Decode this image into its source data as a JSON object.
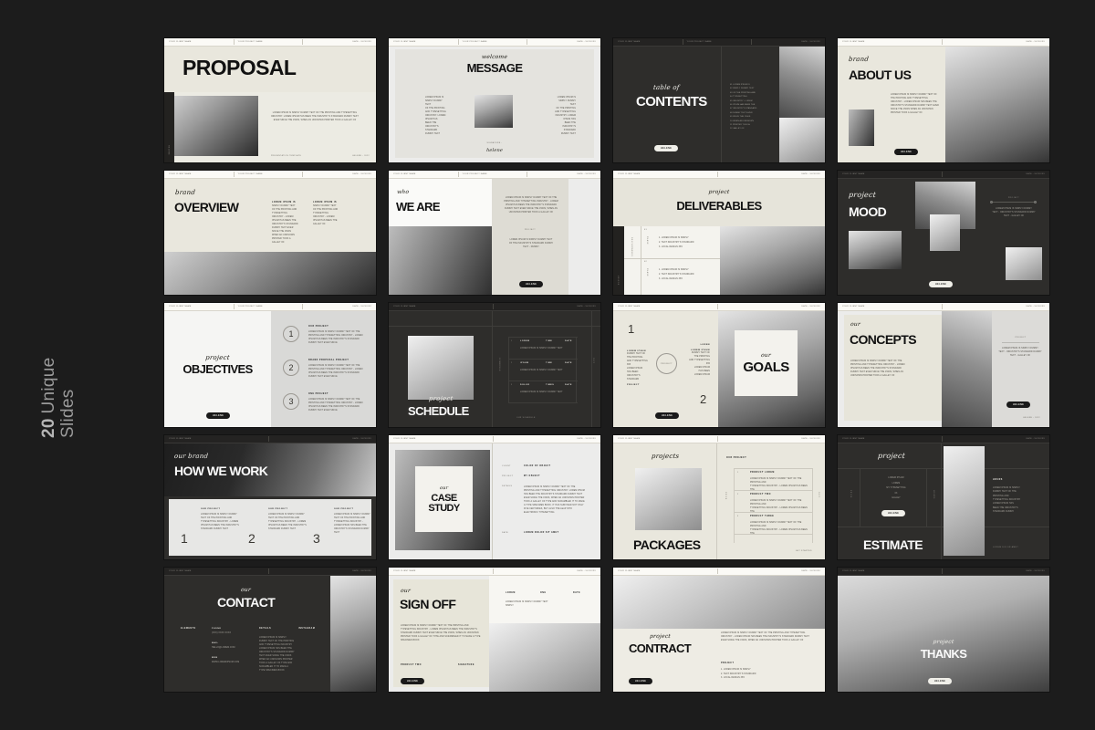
{
  "side_label": {
    "number": "20",
    "text": "Unique",
    "text2": "Slides"
  },
  "background_color": "#1c1c1c",
  "header": {
    "client": "YOUR CLIENT NAME",
    "project": "YOUR PROJECT NAME",
    "date": "DATE - XX/XX/XX"
  },
  "common": {
    "brand_pill": "HELENE",
    "lorem_short": "LOREM IPSUM IS SIMPLY DUMMY TEXT OF THE PRINTING AND TYPESETTING INDUSTRY. LOREM IPSUM HAS BEEN THE INDUSTRY'S STANDARD DUMMY TEXT EVER SINCE THE 1500S, WHEN AN UNKNOWN PRINTER TOOK A GALLEY OF",
    "lorem_tiny": "LOREM IPSUM IS SIMPLY DUMMY TEXT OF THE PRINTING AND TYPESETTING INDUSTRY. LOREM IPSUM HAS BEEN THE",
    "project_label": "PROJECT",
    "our_project": "OUR PROJECT"
  },
  "slides": [
    {
      "n": 1,
      "id": "proposal",
      "title": "PROPOSAL",
      "script": "",
      "footer_left": "PRESENTATION TEMPLATE",
      "footer_right": "HELENE  -  2022",
      "body": "LOREM IPSUM IS SIMPLY DUMMY TEXT OF THE PRINTING AND TYPESETTING INDUSTRY. LOREM IPSUM HAS BEEN THE INDUSTRY'S STANDARD DUMMY TEXT EVER SINCE THE 1500S, WHEN AN UNKNOWN PRINTER TOOK A GALLEY OF",
      "side_tag": "HELENE"
    },
    {
      "n": 2,
      "id": "message",
      "title": "MESSAGE",
      "script": "welcome",
      "signature_label": "SIGNATURE :",
      "signature": "helene",
      "col_left": "LOREM IPSUM IS\nSIMPLY DUMMY\nTEXT\nOF THE PRINTING\nAND TYPESETTING\nINDUSTRY. LOREM\nIPSUM HAS\nBEEN THE\nINDUSTRY'S\nSTANDARD\nDUMMY TEXT",
      "col_right": "LOREM IPSUM IS\nSIMPLY DUMMY\nTEXT\nOF THE PRINTING\nAND TYPESETTING\nINDUSTRY. LOREM\nIPSUM HAS\nBEEN THE\nINDUSTRY'S\nSTANDARD\nDUMMY TEXT"
    },
    {
      "n": 3,
      "id": "contents",
      "title": "CONTENTS",
      "script": "table of",
      "pill": "HELENE",
      "items": [
        "01  LOREM IPSUM IS",
        "02  SIMPLY DUMMY TEXT",
        "03  OF THE PRINTING AND",
        "04  TYPESETTING",
        "05  INDUSTRY - LOREM",
        "06  IPSUM HAS BEEN THE",
        "07  INDUSTRY'S STANDARD",
        "08  DUMMY TEXT EVER",
        "09  SINCE THE 1500S",
        "10  WHEN AN UNKNOWN",
        "11  PRINTER TOOK A",
        "12  GALLEY OF"
      ]
    },
    {
      "n": 4,
      "id": "about-us",
      "title": "ABOUT US",
      "script": "brand",
      "pill": "HELENE",
      "body": "LOREM IPSUM IS SIMPLY DUMMY TEXT OF THE PRINTING AND TYPESETTING INDUSTRY - LOREM IPSUM HAS BEEN THE INDUSTRY'S STANDARD DUMMY TEXT EVER SINCE THE 1500S WHEN AN UNKNOWN PRINTER TOOK A GALLEY OF"
    },
    {
      "n": 5,
      "id": "overview",
      "title": "OVERVIEW",
      "script": "brand",
      "col1_head": "LOREM IPSUM IS",
      "col1": "SIMPLY DUMMY TEXT\nOF THE PRINTING AND\nTYPESETTING\nINDUSTRY - LOREM\nIPSUM HAS BEEN THE\nINDUSTRY'S STANDARD\nDUMMY TEXT EVER\nSINCE THE 1500S\nWHEN AN UNKNOWN\nPRINTER TOOK A\nGALLEY OF",
      "col2_head": "LOREM IPSUM IS",
      "col2": "SIMPLY DUMMY TEXT\nOF THE PRINTING AND\nTYPESETTING\nINDUSTRY - LOREM\nIPSUM HAS BEEN THE\nGALLEY OF"
    },
    {
      "n": 6,
      "id": "we-are",
      "title": "WE ARE",
      "script": "who",
      "pill": "HELENE",
      "mid_label": "PROJECT",
      "body": "LOREM IPSUM IS SIMPLY DUMMY TEXT OF THE PRINTING AND TYPESETTING INDUSTRY - LOREM IPSUM HAS BEEN THE INDUSTRY'S STANDARD DUMMY TEXT EVER SINCE THE 1500S, WHEN AN UNKNOWN PRINTER TOOK A GALLEY OF",
      "body2": "LOREM IPSUM IS SIMPLY DUMMY TEXT\nOF THE INDUSTRY'S STANDARD DUMMY\nTEXT - DUMMY"
    },
    {
      "n": 7,
      "id": "deliverables",
      "title": "DELIVERABLES",
      "script": "project",
      "side_tag": "HELENE",
      "vtext": "DELIVERABLES",
      "groups": [
        {
          "label": "01",
          "vlabel": "PHASE",
          "items": [
            "1.  LOREM IPSUM IS SIMPLY",
            "2.  TEXT INDUSTRY'S STANDARD",
            "3.  LOCAL DESIGN 365"
          ]
        },
        {
          "label": "02",
          "vlabel": "PHASE",
          "items": [
            "1.  LOREM IPSUM IS SIMPLY",
            "2.  TEXT INDUSTRY'S STANDARD",
            "3.  LOCAL DESIGN 365"
          ]
        }
      ]
    },
    {
      "n": 8,
      "id": "mood",
      "title": "MOOD",
      "script": "project",
      "pill": "HELENE",
      "right_label": "PROJECT",
      "right_body": "LOREM IPSUM IS SIMPLY DUMMY\nTEXT - INDUSTRY'S STANDARD DUMMY\nTEXT - GALLEY OF"
    },
    {
      "n": 9,
      "id": "objectives",
      "title": "OBJECTIVES",
      "script": "project",
      "pill": "HELENE",
      "rows": [
        {
          "num": "1",
          "head": "OUR PROJECT",
          "body": "LOREM IPSUM IS SIMPLY DUMMY TEXT OF THE PRINTING AND TYPESETTING INDUSTRY - LOREM IPSUM HAS BEEN THE INDUSTRY'S STANDARD DUMMY TEXT EVER SINCE"
        },
        {
          "num": "2",
          "head": "BRAND PROPOSAL PROJECT",
          "body": "LOREM IPSUM IS SIMPLY DUMMY TEXT OF THE PRINTING AND TYPESETTING INDUSTRY - LOREM IPSUM HAS BEEN THE INDUSTRY'S STANDARD DUMMY TEXT EVER SINCE"
        },
        {
          "num": "3",
          "head": "ONE PROJECT",
          "body": "LOREM IPSUM IS SIMPLY DUMMY TEXT OF THE PRINTING AND TYPESETTING INDUSTRY - LOREM IPSUM HAS BEEN THE INDUSTRY'S STANDARD DUMMY TEXT EVER SINCE"
        }
      ]
    },
    {
      "n": 10,
      "id": "schedule",
      "title": "SCHEDULE",
      "script": "project",
      "vtext_left": "SCHEDULE",
      "vtext_right": "2022",
      "footer": "OUR  SCHEDULE",
      "rows": [
        {
          "num": "1",
          "c1": "LOREM",
          "c2": "TIME",
          "c3": "DATE",
          "sub": "LOREM IPSUM IS SIMPLY DUMMY TEXT"
        },
        {
          "num": "2",
          "c1": "IPSUM",
          "c2": "TIME",
          "c3": "DATE",
          "sub": "LOREM IPSUM IS SIMPLY DUMMY TEXT"
        },
        {
          "num": "3",
          "c1": "DOLOR",
          "c2": "TIMES",
          "c3": "DATE",
          "sub": "LOREM IPSUM IS SIMPLY DUMMY TEXT"
        }
      ]
    },
    {
      "n": 11,
      "id": "goals",
      "title": "GOALS",
      "script": "our",
      "pill": "HELENE",
      "circle_label": "PROJECT",
      "num1": "1",
      "num2": "2",
      "col1_head": "LOREM IPSUM",
      "col1": "DUMMY TEXT OF\nTHE PRINTING\nAND TYPESETTING\n365\nLOREM IPSUM\nHAS BEEN\nINDUSTRY'S\nSTANDARD",
      "col1_foot": "PROJECT",
      "col2_head": "LOREM IPSUM",
      "col2": "DUMMY TEXT OF\nTHE PRINTING\nAND TYPESETTING\n365\nLOREM IPSUM\nHAS BEEN\nLOREM IPSUM",
      "col2_top": "LOREM"
    },
    {
      "n": 12,
      "id": "concepts",
      "title": "CONCEPTS",
      "script": "our",
      "pill": "HELENE",
      "right_label": "PROJECT",
      "footer": "HELENE  -  2022",
      "body": "LOREM IPSUM IS SIMPLY DUMMY TEXT OF THE PRINTING AND TYPESETTING INDUSTRY - LOREM IPSUM HAS BEEN THE INDUSTRY'S STANDARD DUMMY TEXT EVER SINCE THE 1500S, WHEN AN UNKNOWN PRINTER TOOK A GALLEY OF",
      "right_body": "LOREM IPSUM IS SIMPLY DUMMY\nTEXT - INDUSTRY'S STANDARD DUMMY\nTEXT - GALLEY OF"
    },
    {
      "n": 13,
      "id": "how-we-work",
      "title": "HOW WE WORK",
      "script": "our brand",
      "cols": [
        {
          "num": "1",
          "head": "OUR PROJECT",
          "body": "LOREM IPSUM IS SIMPLY DUMMY TEXT OF THE PRINTING AND TYPESETTING INDUSTRY - LOREM IPSUM HAS BEEN THE INDUSTRY'S STANDARD DUMMY TEXT"
        },
        {
          "num": "2",
          "head": "OUR PROJECT",
          "body": "LOREM IPSUM IS SIMPLY DUMMY TEXT OF THE PRINTING AND TYPESETTING INDUSTRY - LOREM IPSUM HAS BEEN THE INDUSTRY'S STANDARD DUMMY TEXT"
        },
        {
          "num": "3",
          "head": "OUR PROJECT",
          "body": "LOREM IPSUM IS SIMPLY DUMMY TEXT OF THE PRINTING AND TYPESETTING INDUSTRY - LOREM IPSUM HAS BEEN THE INDUSTRY'S STANDARD DUMMY TEXT"
        }
      ]
    },
    {
      "n": 14,
      "id": "case-study",
      "title_1": "CASE",
      "title_2": "STUDY",
      "script": "our",
      "rows": [
        {
          "label": "CLIENT",
          "value": "COLOR OF OBJECT"
        },
        {
          "label": "PROJECT",
          "value": "MY OBJECT"
        },
        {
          "label": "DETAILS",
          "value": "LOREM IPSUM IS SIMPLY DUMMY TEXT OF THE PRINTING AND TYPESETTING INDUSTRY. LOREM IPSUM HAS BEEN THE INDUSTRY'S STANDARD DUMMY TEXT EVER SINCE THE 1500S, WHEN AN UNKNOWN PRINTER TOOK A GALLEY OF TYPE AND SCRAMBLED IT TO MAKE A TYPE SPECIMEN BOOK. IT HAS SURVIVED NOT ONLY FIVE CENTURIES, BUT ALSO THE LEAP INTO ELECTRONIC TYPESETTING"
        },
        {
          "label": "DATE",
          "value": "LOREM DOLOR SIT AMET"
        }
      ]
    },
    {
      "n": 15,
      "id": "packages",
      "title": "PACKAGES",
      "script": "projects",
      "head": "OUR PROJECT",
      "footer": "GET STARTED",
      "vtext_left": "PRICE",
      "vtext_right": "2022",
      "rows": [
        {
          "num": "1",
          "head": "PRODUCT LOREM",
          "body": "LOREM IPSUM IS SIMPLY DUMMY TEXT OF THE PRINTING AND\nTYPESETTING INDUSTRY - LOREM IPSUM HAS BEEN THE"
        },
        {
          "num": "2",
          "head": "PRODUCT TWO",
          "body": "LOREM IPSUM IS SIMPLY DUMMY TEXT OF THE PRINTING AND\nTYPESETTING INDUSTRY - LOREM IPSUM HAS BEEN THE"
        },
        {
          "num": "3",
          "head": "PRODUCT THREE",
          "body": "LOREM IPSUM IS SIMPLY DUMMY TEXT OF THE PRINTING AND\nTYPESETTING INDUSTRY - LOREM IPSUM HAS BEEN THE"
        }
      ]
    },
    {
      "n": 16,
      "id": "estimate",
      "title": "ESTIMATE",
      "script": "project",
      "pill": "HELENE",
      "footer": "LOREM DOLOR AMET",
      "right_head": "HOURS",
      "vtext_left": "PRICE",
      "vtext_right": "HOURS",
      "left_list": "LOREM IPSUM\nLOREM\nMY TYPESETTING\n03\nGALLEY",
      "right_list": "LOREM IPSUM IS SIMPLY\nDUMMY TEXT OF THE\nPRINTING AND\nTYPESETTING INDUSTRY\nLOREM IPSUM HAS\nBEEN THE INDUSTRY'S\nSTANDARD DUMMY"
    },
    {
      "n": 17,
      "id": "contact",
      "title": "CONTACT",
      "script": "our",
      "col1_head": "ELEMENTS",
      "cols": [
        {
          "head": "PHONE",
          "body": "(XXX) XXXX XXXX"
        },
        {
          "head": "MAIL",
          "body": "HELLO@LOREM.COM"
        },
        {
          "head": "WEB",
          "body": "WWW.LOREMIPSUM.COM"
        }
      ],
      "detail_head": "DETAILS",
      "detail_body": "LOREM IPSUM IS SIMPLY\nDUMMY TEXT OF THE PRINTING\nAND TYPESETTING INDUSTRY\nLOREM IPSUM HAS BEEN THE\nINDUSTRY'S STANDARD DUMMY\nTEXT EVER SINCE THE 1500S\nWHEN AN UNKNOWN PRINTER\nTOOK A GALLEY OF TYPE AND\nSCRAMBLED IT TO MAKE A\nTYPE SPECIMEN BOOK",
      "right_head": "INSTAGRAM"
    },
    {
      "n": 18,
      "id": "sign-off",
      "title": "SIGN OFF",
      "script": "our",
      "pill": "HELENE",
      "meta": [
        {
          "label": "LOREM",
          "value": ""
        },
        {
          "label": "ONE",
          "value": ""
        },
        {
          "label": "DATE",
          "value": ""
        }
      ],
      "meta_sub": "LOREM IPSUM IS SIMPLY DUMMY TEXT\nSIMPLY",
      "body": "LOREM IPSUM IS SIMPLY DUMMY TEXT OF THE PRINTING AND TYPESETTING INDUSTRY - LOREM IPSUM HAS BEEN THE INDUSTRY'S STANDARD DUMMY TEXT EVER SINCE THE 1500S, WHEN AN UNKNOWN PRINTER TOOK A GALLEY OF TYPE AND SCRAMBLED IT TO MAKE A TYPE SPECIMEN BOOK",
      "foot_left": "PRODUCT TWO",
      "foot_right": "SIGNATURE"
    },
    {
      "n": 19,
      "id": "contract",
      "title": "CONTRACT",
      "script": "project",
      "pill": "HELENE",
      "body": "LOREM IPSUM IS SIMPLY DUMMY TEXT OF THE PRINTING AND TYPESETTING INDUSTRY - LOREM IPSUM HAS BEEN THE INDUSTRY'S STANDARD DUMMY TEXT EVER SINCE THE 1500S, WHEN AN UNKNOWN PRINTER TOOK A GALLEY OF",
      "foot_head": "PROJECT",
      "foot_body": "1.  LOREM IPSUM IS SIMPLY\n2.  TEXT INDUSTRY'S STANDARD\n3.  LOCAL DESIGN 365"
    },
    {
      "n": 20,
      "id": "thanks",
      "title": "THANKS",
      "script": "project",
      "pill": "HELENE"
    }
  ]
}
